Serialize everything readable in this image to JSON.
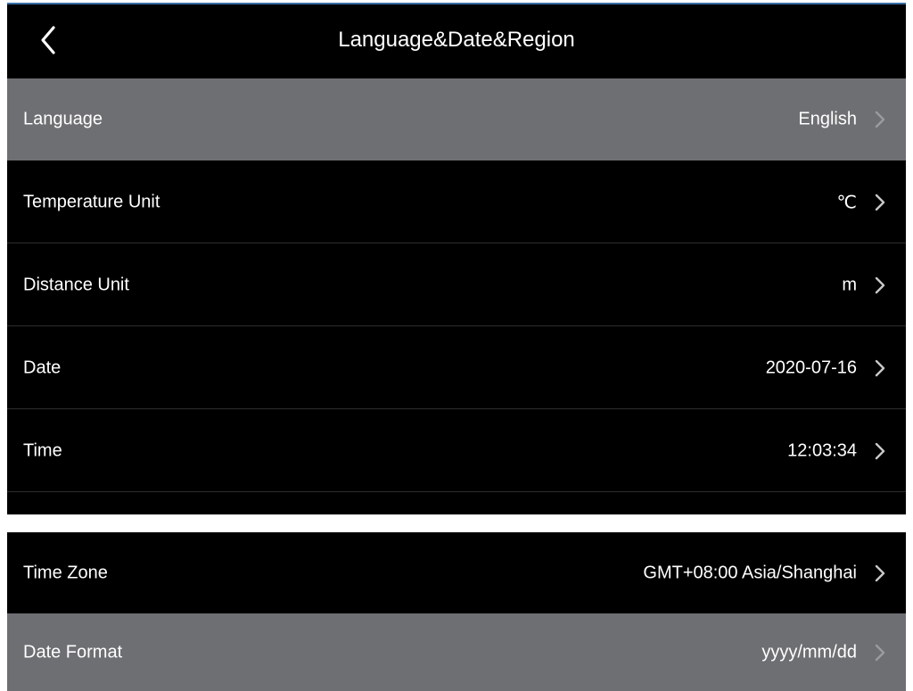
{
  "header": {
    "title": "Language&Date&Region",
    "back_icon": "chevron-left-icon"
  },
  "rows": [
    {
      "label": "Language",
      "value": "English"
    },
    {
      "label": "Temperature Unit",
      "value": "℃"
    },
    {
      "label": "Distance Unit",
      "value": "m"
    },
    {
      "label": "Date",
      "value": "2020-07-16"
    },
    {
      "label": "Time",
      "value": "12:03:34"
    },
    {
      "label": "Time Zone",
      "value": "GMT+08:00 Asia/Shanghai"
    },
    {
      "label": "Date Format",
      "value": "yyyy/mm/dd"
    }
  ],
  "colors": {
    "background": "#000000",
    "highlight": "#6e6f72",
    "accent_line": "#3a6ea8"
  }
}
